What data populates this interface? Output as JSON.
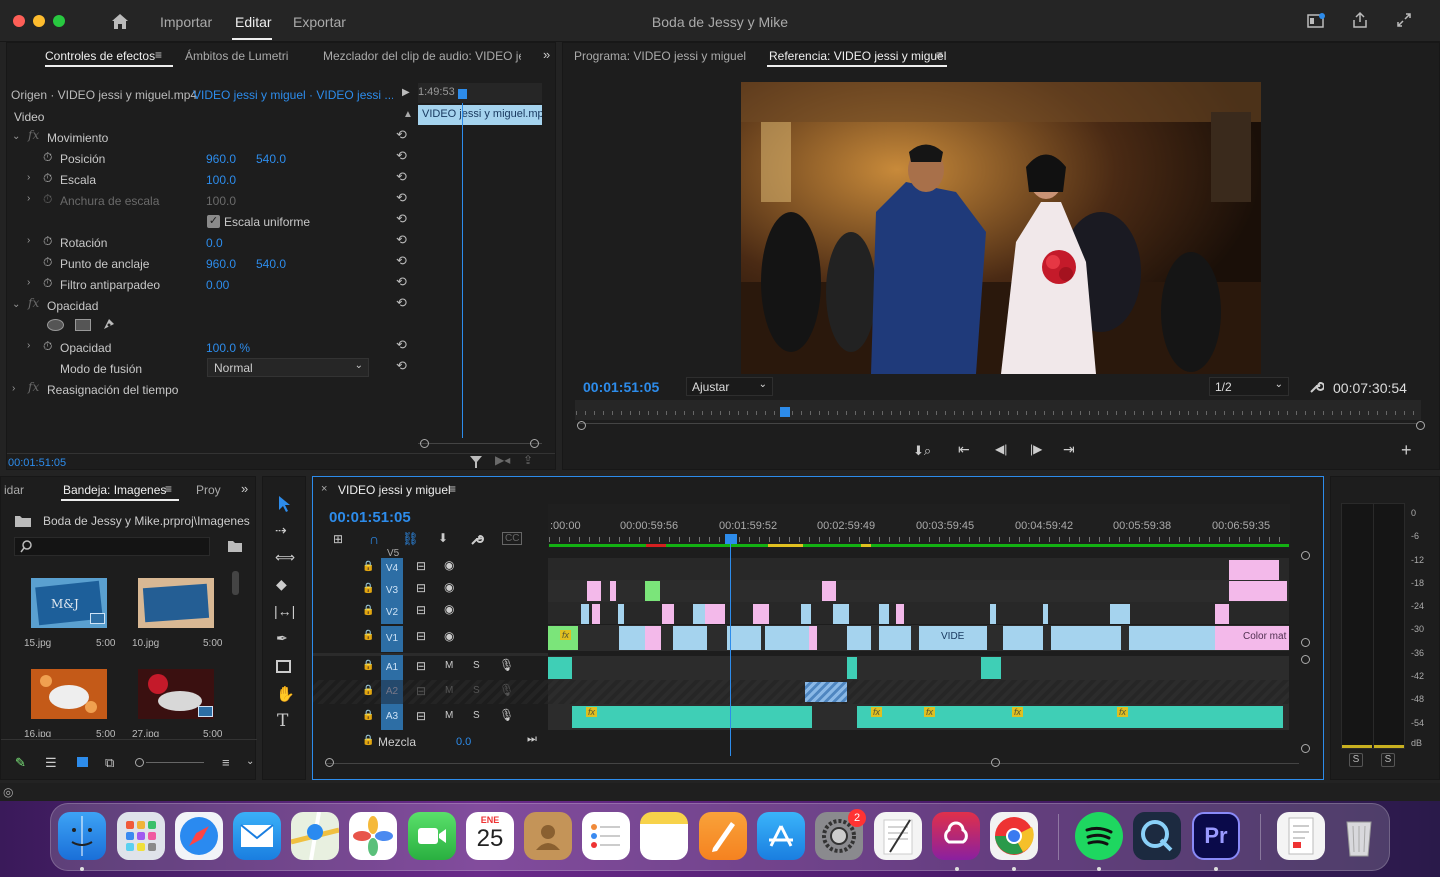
{
  "window": {
    "title": "Boda de Jessy y Mike",
    "menus": [
      "Importar",
      "Editar",
      "Exportar"
    ],
    "active_menu": "Editar"
  },
  "effects": {
    "tabs": [
      "Controles de efectos",
      "Ámbitos de Lumetri",
      "Mezclador del clip de audio: VIDEO jessi"
    ],
    "source": "Origen · VIDEO jessi y miguel.mp4",
    "sequence": "VIDEO jessi y miguel · VIDEO jessi ...",
    "mini_time": "1:49:53",
    "clip_label": "VIDEO jessi y miguel.mp",
    "section": "Video",
    "rows": [
      {
        "name": "Movimiento",
        "v1": "",
        "v2": ""
      },
      {
        "name": "Posición",
        "v1": "960.0",
        "v2": "540.0"
      },
      {
        "name": "Escala",
        "v1": "100.0",
        "v2": ""
      },
      {
        "name": "Anchura de escala",
        "v1": "100.0",
        "v2": ""
      },
      {
        "name": "Escala uniforme",
        "v1": "",
        "v2": ""
      },
      {
        "name": "Rotación",
        "v1": "0.0",
        "v2": ""
      },
      {
        "name": "Punto de anclaje",
        "v1": "960.0",
        "v2": "540.0"
      },
      {
        "name": "Filtro antiparpadeo",
        "v1": "0.00",
        "v2": ""
      },
      {
        "name": "Opacidad",
        "v1": "",
        "v2": ""
      },
      {
        "name": "Opacidad",
        "v1": "100.0 %",
        "v2": ""
      },
      {
        "name": "Modo de fusión",
        "v1": "Normal",
        "v2": ""
      },
      {
        "name": "Reasignación del tiempo",
        "v1": "",
        "v2": ""
      }
    ],
    "timecode": "00:01:51:05"
  },
  "monitor": {
    "tabs": [
      "Programa: VIDEO jessi y miguel",
      "Referencia: VIDEO jessi y miguel"
    ],
    "timecode": "00:01:51:05",
    "fit": "Ajustar",
    "resolution": "1/2",
    "duration": "00:07:30:54"
  },
  "project": {
    "tabs": [
      "idar",
      "Bandeja: Imagenes",
      "Proy"
    ],
    "path": "Boda de Jessy y Mike.prproj\\Imagenes",
    "search_placeholder": "",
    "items": [
      {
        "name": "15.jpg",
        "dur": "5:00"
      },
      {
        "name": "10.jpg",
        "dur": "5:00"
      },
      {
        "name": "16.jpg",
        "dur": "5:00"
      },
      {
        "name": "27.jpg",
        "dur": "5:00"
      }
    ]
  },
  "timeline": {
    "name": "VIDEO jessi y miguel",
    "timecode": "00:01:51:05",
    "ruler": [
      ":00:00",
      "00:00:59:56",
      "00:01:59:52",
      "00:02:59:49",
      "00:03:59:45",
      "00:04:59:42",
      "00:05:59:38",
      "00:06:59:35"
    ],
    "video_tracks": [
      "V5",
      "V4",
      "V3",
      "V2",
      "V1"
    ],
    "audio_tracks": [
      "A1",
      "A2",
      "A3"
    ],
    "mix_label": "Mezcla",
    "mix_value": "0.0",
    "clip_texts": [
      "VIDE",
      "Color mat"
    ]
  },
  "meter": {
    "scale": [
      "0",
      "-6",
      "-12",
      "-18",
      "-24",
      "-30",
      "-36",
      "-42",
      "-48",
      "-54",
      "dB"
    ],
    "solo": [
      "S",
      "S"
    ]
  },
  "dock": {
    "calendar_month": "ENE",
    "calendar_day": "25",
    "badge": "2",
    "premiere": "Pr"
  }
}
